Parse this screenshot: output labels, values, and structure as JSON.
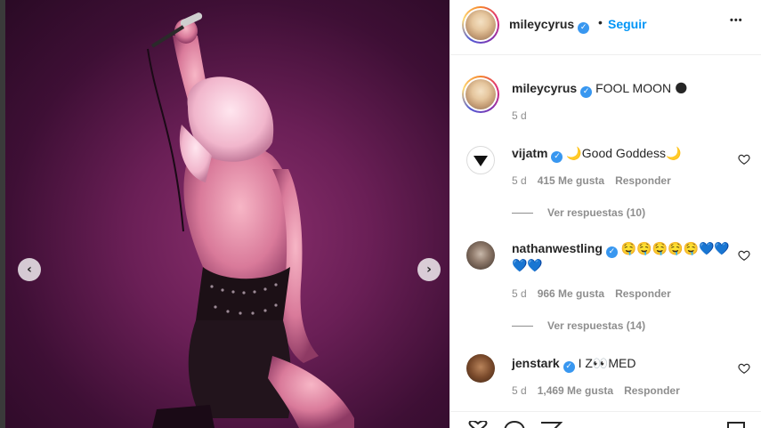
{
  "post": {
    "author": "mileycyrus",
    "follow_label": "Seguir",
    "separator": "•",
    "more_label": "•••",
    "caption_text": "FOOL MOON 🌑",
    "caption_time": "5 d"
  },
  "comments": [
    {
      "username": "vijatm",
      "text": "🌙Good Goddess🌙",
      "time": "5 d",
      "likes": "415 Me gusta",
      "reply_label": "Responder",
      "view_replies": "Ver respuestas (10)"
    },
    {
      "username": "nathanwestling",
      "text_line1": "🤤🤤🤤🤤🤤💙💙",
      "text_line2": "💙💙",
      "time": "5 d",
      "likes": "966 Me gusta",
      "reply_label": "Responder",
      "view_replies": "Ver respuestas (14)"
    },
    {
      "username": "jenstark",
      "text": "I Z👀MED",
      "time": "5 d",
      "likes": "1,469 Me gusta",
      "reply_label": "Responder"
    }
  ],
  "media": {
    "prev_icon": "‹",
    "next_icon": "›"
  },
  "colors": {
    "accent": "#0095f6",
    "verified": "#3897f0",
    "stage_bg": "#6a1f56"
  },
  "icons": [
    "verified-badge-icon",
    "heart-icon",
    "chevron-left-icon",
    "chevron-right-icon",
    "more-icon",
    "comment-icon",
    "share-icon",
    "bookmark-icon"
  ]
}
